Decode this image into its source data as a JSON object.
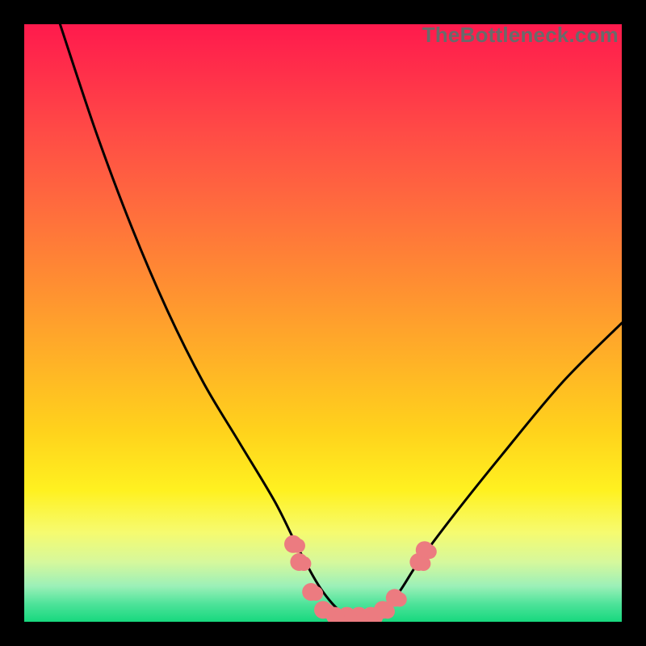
{
  "watermark": {
    "text": "TheBottleneck.com"
  },
  "chart_data": {
    "type": "line",
    "title": "",
    "xlabel": "",
    "ylabel": "",
    "xlim": [
      0,
      100
    ],
    "ylim": [
      0,
      100
    ],
    "grid": false,
    "legend": false,
    "series": [
      {
        "name": "curve",
        "color": "#000000",
        "x": [
          6,
          12,
          18,
          24,
          30,
          36,
          42,
          46,
          50,
          54,
          58,
          62,
          66,
          72,
          80,
          90,
          100
        ],
        "y": [
          100,
          82,
          66,
          52,
          40,
          30,
          20,
          12,
          5,
          1,
          1,
          4,
          10,
          18,
          28,
          40,
          50
        ]
      }
    ],
    "annotations": {
      "pink_clusters": {
        "color": "#ec7b80",
        "points": [
          {
            "x": 45,
            "y": 13
          },
          {
            "x": 46,
            "y": 10
          },
          {
            "x": 48,
            "y": 5
          },
          {
            "x": 50,
            "y": 2
          },
          {
            "x": 52,
            "y": 1
          },
          {
            "x": 54,
            "y": 1
          },
          {
            "x": 56,
            "y": 1
          },
          {
            "x": 58,
            "y": 1
          },
          {
            "x": 60,
            "y": 2
          },
          {
            "x": 62,
            "y": 4
          },
          {
            "x": 66,
            "y": 10
          },
          {
            "x": 67,
            "y": 12
          }
        ]
      }
    }
  },
  "colors": {
    "gradient_top": "#ff1a4d",
    "gradient_orange": "#ff8a33",
    "gradient_yellow": "#fff120",
    "gradient_green": "#17d87e",
    "curve": "#000000",
    "marker": "#ec7b80",
    "frame": "#000000"
  }
}
